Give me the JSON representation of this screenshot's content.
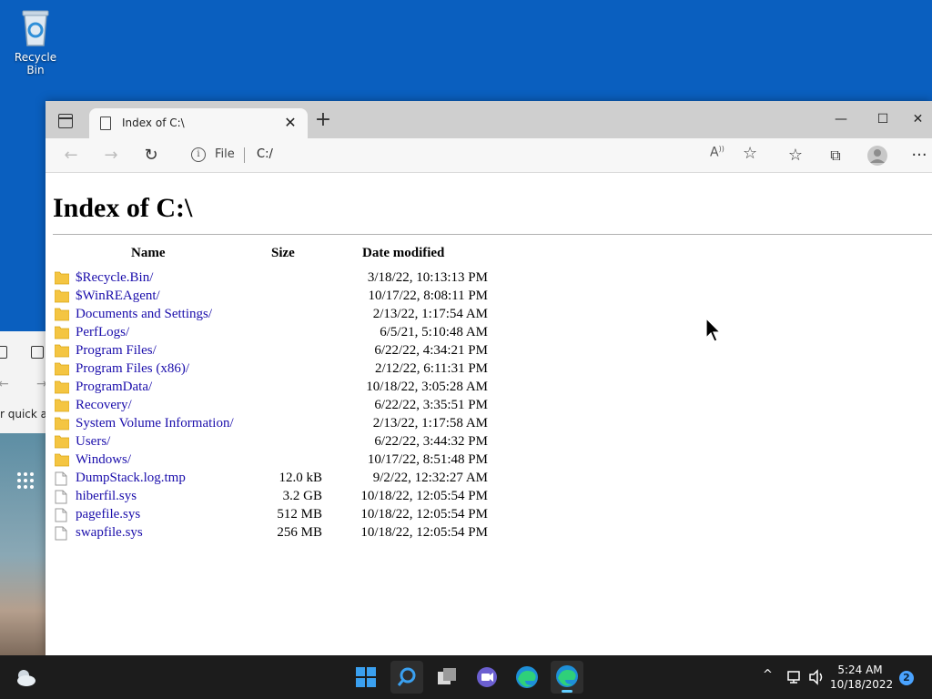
{
  "desktop": {
    "recycle_bin_label": "Recycle Bin",
    "background_window_text": "r quick a"
  },
  "browser": {
    "tab_title": "Index of C:\\",
    "address": {
      "scheme_label": "File",
      "url": "C:/"
    }
  },
  "page": {
    "heading": "Index of C:\\",
    "columns": {
      "name": "Name",
      "size": "Size",
      "date": "Date modified"
    },
    "entries": [
      {
        "name": "$Recycle.Bin/",
        "size": "",
        "date": "3/18/22, 10:13:13 PM",
        "type": "folder"
      },
      {
        "name": "$WinREAgent/",
        "size": "",
        "date": "10/17/22, 8:08:11 PM",
        "type": "folder"
      },
      {
        "name": "Documents and Settings/",
        "size": "",
        "date": "2/13/22, 1:17:54 AM",
        "type": "folder"
      },
      {
        "name": "PerfLogs/",
        "size": "",
        "date": "6/5/21, 5:10:48 AM",
        "type": "folder"
      },
      {
        "name": "Program Files/",
        "size": "",
        "date": "6/22/22, 4:34:21 PM",
        "type": "folder"
      },
      {
        "name": "Program Files (x86)/",
        "size": "",
        "date": "2/12/22, 6:11:31 PM",
        "type": "folder"
      },
      {
        "name": "ProgramData/",
        "size": "",
        "date": "10/18/22, 3:05:28 AM",
        "type": "folder"
      },
      {
        "name": "Recovery/",
        "size": "",
        "date": "6/22/22, 3:35:51 PM",
        "type": "folder"
      },
      {
        "name": "System Volume Information/",
        "size": "",
        "date": "2/13/22, 1:17:58 AM",
        "type": "folder"
      },
      {
        "name": "Users/",
        "size": "",
        "date": "6/22/22, 3:44:32 PM",
        "type": "folder"
      },
      {
        "name": "Windows/",
        "size": "",
        "date": "10/17/22, 8:51:48 PM",
        "type": "folder"
      },
      {
        "name": "DumpStack.log.tmp",
        "size": "12.0 kB",
        "date": "9/2/22, 12:32:27 AM",
        "type": "file"
      },
      {
        "name": "hiberfil.sys",
        "size": "3.2 GB",
        "date": "10/18/22, 12:05:54 PM",
        "type": "file"
      },
      {
        "name": "pagefile.sys",
        "size": "512 MB",
        "date": "10/18/22, 12:05:54 PM",
        "type": "file"
      },
      {
        "name": "swapfile.sys",
        "size": "256 MB",
        "date": "10/18/22, 12:05:54 PM",
        "type": "file"
      }
    ]
  },
  "taskbar": {
    "clock_time": "5:24 AM",
    "clock_date": "10/18/2022",
    "notification_count": "2",
    "accent_color": "#60cdff"
  },
  "icons": {
    "folder_color": "#f4c542",
    "link_color": "#1a0dab"
  }
}
